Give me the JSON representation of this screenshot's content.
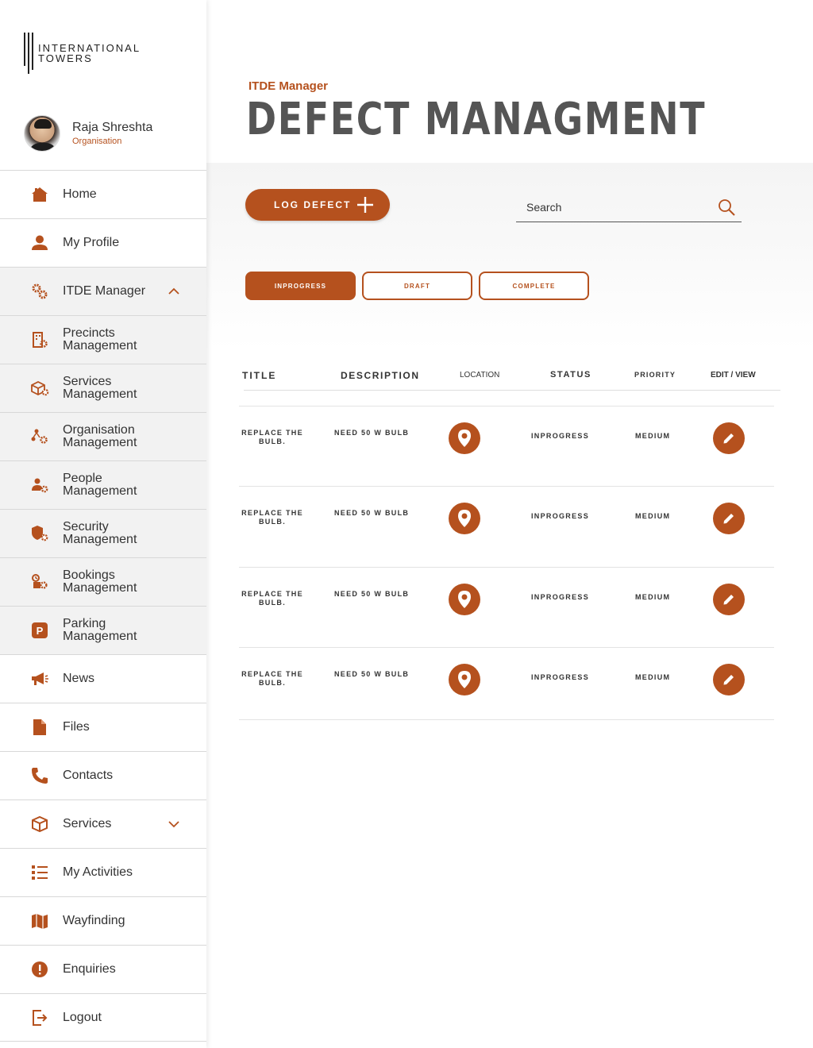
{
  "brand": {
    "name_line1": "INTERNATIONAL",
    "name_line2": "TOWERS",
    "accent": "#b5511e"
  },
  "profile": {
    "name": "Raja Shreshta",
    "org": "Organisation"
  },
  "sidebar": {
    "items": [
      {
        "label": "Home",
        "icon": "home-icon"
      },
      {
        "label": "My Profile",
        "icon": "user-icon"
      },
      {
        "label": "ITDE Manager",
        "icon": "gears-icon",
        "expanded": true
      },
      {
        "label": "Precincts Management",
        "icon": "building-gear-icon"
      },
      {
        "label": "Services Management",
        "icon": "box-gear-icon"
      },
      {
        "label": "Organisation Management",
        "icon": "org-gear-icon"
      },
      {
        "label": "People Management",
        "icon": "people-gear-icon"
      },
      {
        "label": "Security Management",
        "icon": "shield-gear-icon"
      },
      {
        "label": "Bookings Management",
        "icon": "bookings-gear-icon"
      },
      {
        "label": "Parking Management",
        "icon": "parking-icon"
      },
      {
        "label": "News",
        "icon": "megaphone-icon"
      },
      {
        "label": "Files",
        "icon": "file-icon"
      },
      {
        "label": "Contacts",
        "icon": "phone-icon"
      },
      {
        "label": "Services",
        "icon": "box-icon",
        "expanded": false
      },
      {
        "label": "My Activities",
        "icon": "list-icon"
      },
      {
        "label": "Wayfinding",
        "icon": "map-icon"
      },
      {
        "label": "Enquiries",
        "icon": "alert-icon"
      },
      {
        "label": "Logout",
        "icon": "logout-icon"
      }
    ]
  },
  "header": {
    "subtitle": "ITDE Manager",
    "title": "DEFECT MANAGMENT"
  },
  "toolbar": {
    "log_defect_label": "LOG DEFECT",
    "search_placeholder": "Search"
  },
  "tabs": [
    {
      "label": "INPROGRESS",
      "active": true
    },
    {
      "label": "DRAFT",
      "active": false
    },
    {
      "label": "COMPLETE",
      "active": false
    }
  ],
  "table": {
    "columns": [
      "TITLE",
      "DESCRIPTION",
      "LOCATION",
      "STATUS",
      "PRIORITY",
      "EDIT / VIEW"
    ],
    "rows": [
      {
        "title": "REPLACE THE BULB.",
        "description": "NEED 50 W BULB",
        "status": "INPROGRESS",
        "priority": "MEDIUM"
      },
      {
        "title": "REPLACE THE BULB.",
        "description": "NEED 50 W BULB",
        "status": "INPROGRESS",
        "priority": "MEDIUM"
      },
      {
        "title": "REPLACE THE BULB.",
        "description": "NEED 50 W BULB",
        "status": "INPROGRESS",
        "priority": "MEDIUM"
      },
      {
        "title": "REPLACE THE BULB.",
        "description": "NEED 50 W BULB",
        "status": "INPROGRESS",
        "priority": "MEDIUM"
      }
    ]
  }
}
